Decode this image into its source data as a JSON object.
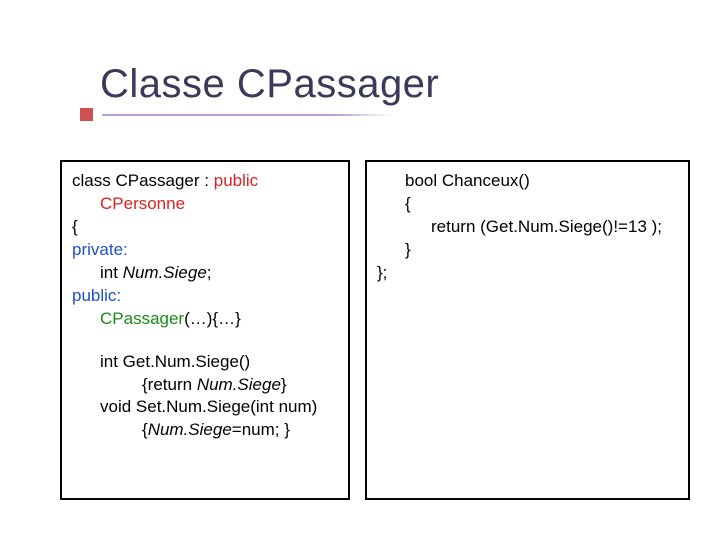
{
  "title": "Classe CPassager",
  "left": {
    "l1a": "class CPassager : ",
    "l1b": "public",
    "l2": "CPersonne",
    "l3": "{",
    "l4": "private:",
    "l5a": "int ",
    "l5b": "Num.Siege",
    "l5c": ";",
    "l6": "public:",
    "l7a": "CPassager",
    "l7b": "(…){…}",
    "l8": "int Get.Num.Siege()",
    "l9a": "{return ",
    "l9b": "Num.Siege",
    "l9c": "}",
    "l10": "void Set.Num.Siege(int num)",
    "l11a": "{",
    "l11b": "Num.Siege",
    "l11c": "=num; }"
  },
  "right": {
    "r1": "bool Chanceux()",
    "r2": "{",
    "r3": "return (Get.Num.Siege()!=13 );",
    "r4": "}",
    "r5": "};"
  }
}
